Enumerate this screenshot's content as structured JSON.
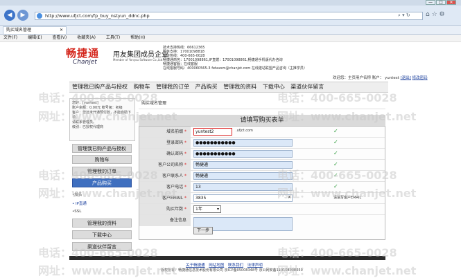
{
  "browser": {
    "url": "http://www.ufjct.com/fp_buy_nstyun_ddnc.php",
    "tab_title": "购买域名管理",
    "menu": [
      "文件(F)",
      "编辑(E)",
      "查看(V)",
      "收藏夹(A)",
      "工具(T)",
      "帮助(H)"
    ],
    "back_icon": "back-arrow-icon",
    "forward_icon": "forward-arrow-icon",
    "min": "—",
    "max": "□",
    "close": "✕"
  },
  "brand": {
    "logo": "畅捷通",
    "logo_en": "Chanjet",
    "partner": "用友集团成员企业",
    "partner_sub": "Member of Yonyou Software Co.,Ltd."
  },
  "support": [
    "技术支持热线：66612365",
    "服务支持：17001098818",
    "值班热线：400-665-0028",
    "畅捷通商务：17001098861,IP直拨：17001098861,畅捷通手机版代办咨询",
    "畅捷通客服：在线客服",
    "在线客服号码：400060565-3 fetaxsm@chanjet.com  在线建站联盟产品咨询（主推学员）"
  ],
  "welcome": {
    "prefix": "欢迎您：主页用户名称",
    "account_label": "账户：",
    "account": "yuntest",
    "logout": "[退出]",
    "change_pw": "修改密码"
  },
  "topnav": [
    "管理我已购产品与授权",
    "购物车",
    "管理我的订单",
    "产品购买",
    "管理我的资料",
    "下载中心",
    "渠道伙伴留言"
  ],
  "userbox": {
    "line1": "您好：[yuntest]",
    "line2": "账户余额：0.00元  帐号级：初级",
    "line3": "客户：您还未开通预付款，不能自助下单。",
    "line4": "请联系管理员。",
    "line5": "级别：已授权代理商"
  },
  "leftnav": {
    "items": [
      "管理我已购产品与授权",
      "购物车",
      "管理我的订单",
      "产品购买"
    ],
    "subitems": [
      "•域名",
      "• IP直通",
      "•SSL"
    ],
    "items2": [
      "管理我的资料",
      "下载中心",
      "渠道伙伴留言"
    ]
  },
  "breadcrumb": "购买域名管理",
  "form": {
    "title": "请填写购买表单",
    "domain_label": "域名前缀",
    "domain_value": "yuntest2",
    "domain_suffix": ".ufjct.com",
    "password_label": "登录密码",
    "password_value": "●●●●●●●●●●●",
    "confirm_label": "确认密码",
    "confirm_value": "●●●●●●●●●●●",
    "company_label": "客户公司名称",
    "company_value": "畅捷通",
    "contact_label": "客户联系人",
    "contact_value": "畅捷通",
    "phone_label": "客户电话",
    "phone_value": "13",
    "email_label": "客户EMAIL",
    "email_value": "3835",
    "email_hint": "请填写客户EMAIL",
    "years_label": "购买年数",
    "years_value": "1年",
    "remark_label": "备注信息",
    "remark_value": "",
    "check": "✓",
    "next_button": "下一步"
  },
  "footer": {
    "links": [
      "关于畅捷通",
      "网站地图",
      "联系我们",
      "法律声明"
    ],
    "copyright": "版权所有：畅捷通信息技术股份有限公司  京ICP备05008348号  京公网安备110108008830"
  },
  "watermark": {
    "phone": "电话：400-665-0028",
    "site": "网址：www.chanjet.net"
  }
}
